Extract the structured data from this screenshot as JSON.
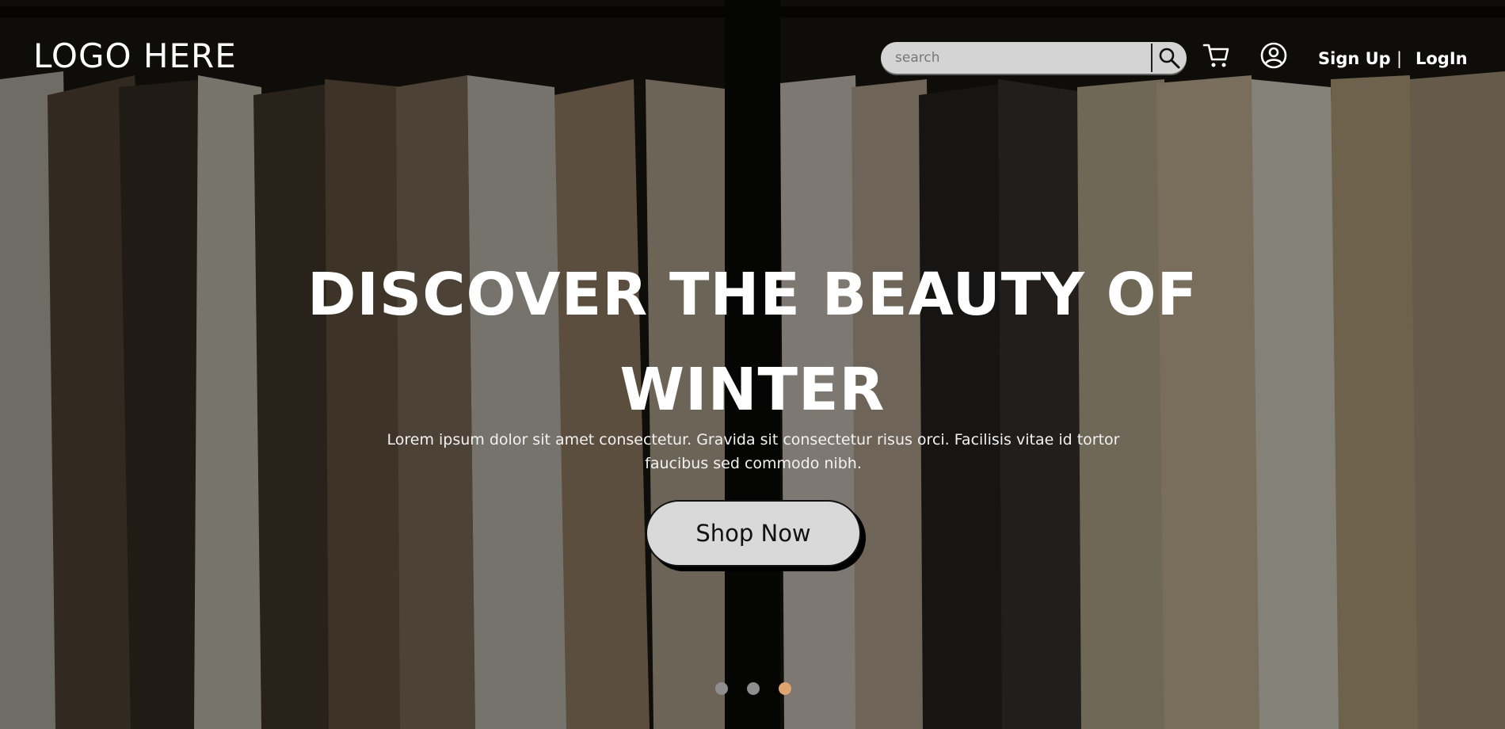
{
  "header": {
    "logo_text": "LOGO HERE",
    "search": {
      "placeholder": "search"
    },
    "cart_icon": "cart-icon",
    "user_icon": "user-circle-icon",
    "signup_label": "Sign Up",
    "separator": "|",
    "login_label": "LogIn"
  },
  "hero": {
    "headline_line1": "DISCOVER THE BEAUTY OF",
    "headline_line2": "WINTER",
    "description": "Lorem ipsum dolor sit amet consectetur. Gravida sit consectetur risus orci. Facilisis vitae id tortor faucibus sed commodo nibh.",
    "cta_label": "Shop Now"
  },
  "carousel": {
    "slide_count": 3,
    "active_index": 2
  },
  "colors": {
    "accent_dot": "#e0a56e",
    "inactive_dot": "#8e8e8e",
    "button_bg": "#d9d9d9",
    "search_bg": "#d4d4d4"
  }
}
